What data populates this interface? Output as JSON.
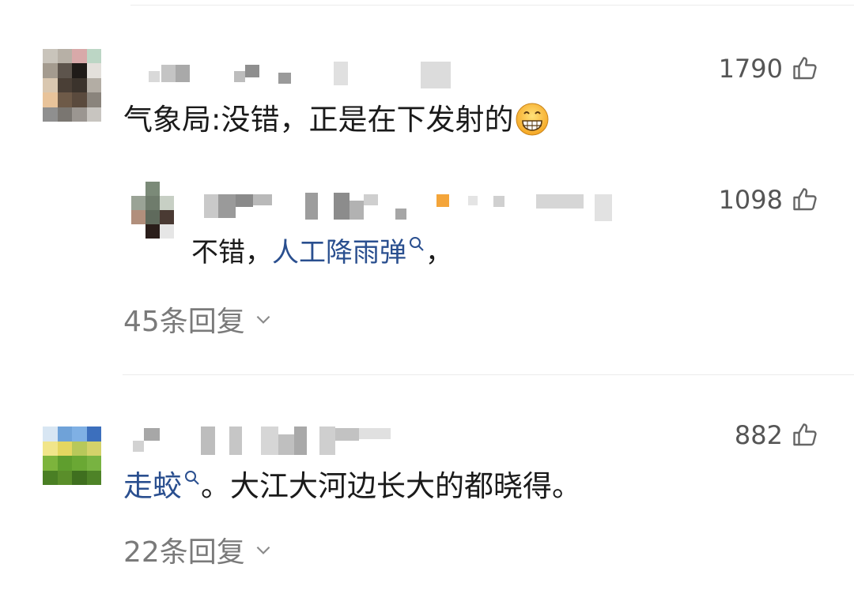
{
  "comments": [
    {
      "text_before": "气象局:没错，正是在下发射的",
      "likes": "1790",
      "replies": {
        "count_label": "45条回复"
      },
      "sub_reply": {
        "text_before": "不错，",
        "link_text": "人工降雨弹",
        "text_after": "，",
        "likes": "1098"
      }
    },
    {
      "link_text": "走蛟",
      "text_after": "。大江大河边长大的都晓得。",
      "likes": "882",
      "replies": {
        "count_label": "22条回复"
      }
    }
  ],
  "icons": {
    "like": "thumbs-up-icon",
    "search": "search-icon",
    "expand": "chevron-down-icon",
    "emoji": "grinning-face-emoji"
  },
  "colors": {
    "link": "#2a4f8f",
    "secondary_text": "#7a7a7a",
    "divider": "#ececec"
  }
}
